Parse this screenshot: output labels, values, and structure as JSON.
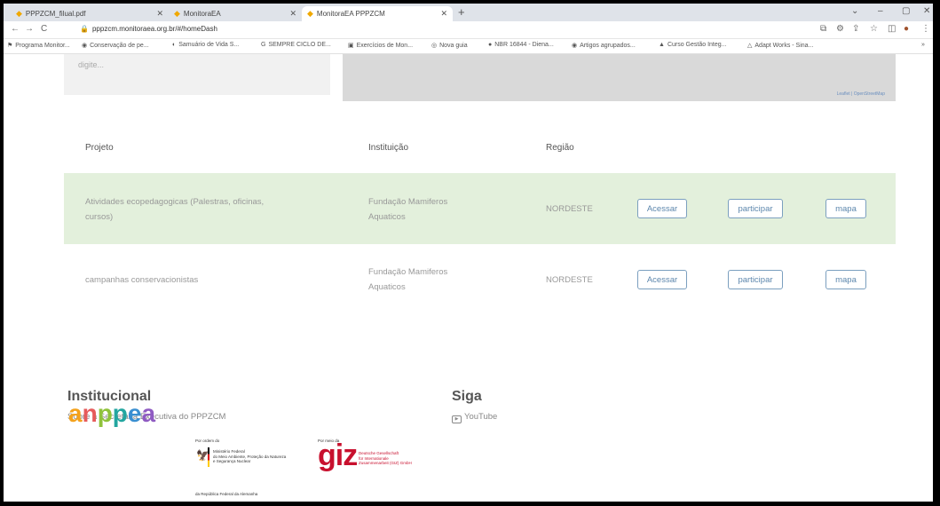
{
  "browser": {
    "tabs": [
      {
        "title": "PPPZCM_filual.pdf",
        "active": false
      },
      {
        "title": "MonitoraEA",
        "active": false
      },
      {
        "title": "MonitoraEA PPPZCM",
        "active": true
      }
    ],
    "url": "pppzcm.monitoraea.org.br/#/homeDash",
    "bookmarks": [
      "Programa Monitor...",
      "Conservação de pe...",
      "Samuário de Vida S...",
      "SEMPRE CICLO DE...",
      "Exercícios de Mon...",
      "Nova guia",
      "NBR 16844 - Diena...",
      "Artigos agrupados...",
      "Curso Gestão Integ...",
      "Adapt Works - Sina..."
    ]
  },
  "search": {
    "placeholder": "digite..."
  },
  "map": {
    "attribution": "Leaflet | OpenStreetMap"
  },
  "table": {
    "headers": {
      "projeto": "Projeto",
      "instituicao": "Instituição",
      "regiao": "Região"
    },
    "rows": [
      {
        "projeto_line1": "Atividades ecopedagogicas (Palestras, oficinas,",
        "projeto_line2": "cursos)",
        "instituicao_line1": "Fundação Mamiferos",
        "instituicao_line2": "Aquaticos",
        "regiao": "NORDESTE",
        "acessar": "Acessar",
        "participar": "participar",
        "mapa": "mapa",
        "highlighted": true
      },
      {
        "projeto_line1": "campanhas conservacionistas",
        "projeto_line2": "",
        "instituicao_line1": "Fundação Mamiferos",
        "instituicao_line2": "Aquaticos",
        "regiao": "NORDESTE",
        "acessar": "Acessar",
        "participar": "participar",
        "mapa": "mapa",
        "highlighted": false
      }
    ]
  },
  "footer": {
    "institucional": {
      "title": "Institucional",
      "link": "Sobre a Secretaria Executiva do PPPZCM"
    },
    "siga": {
      "title": "Siga",
      "youtube": "YouTube"
    },
    "logos": {
      "anppea": "anppea",
      "ministry_caption_top": "Por ordem do",
      "ministry_line1": "Ministério Federal",
      "ministry_line2": "do Meio Ambiente, Proteção da Natureza",
      "ministry_line3": "e Segurança Nuclear",
      "ministry_caption_bottom": "da República Federal da Alemanha",
      "giz_caption": "Por meio da",
      "giz": "giz",
      "giz_line1": "Deutsche Gesellschaft",
      "giz_line2": "für Internationale",
      "giz_line3": "Zusammenarbeit (GIZ) GmbH"
    }
  },
  "colors": {
    "highlight_row": "#e3f0dc",
    "button_border": "#7b9fbf",
    "giz_red": "#c8102e"
  }
}
